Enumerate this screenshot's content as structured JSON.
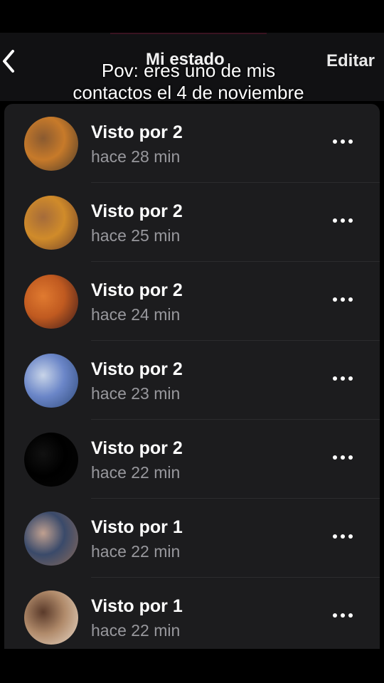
{
  "header": {
    "title": "Mi estado",
    "edit_label": "Editar",
    "back_icon": "chevron-left-icon"
  },
  "overlay_caption": "Pov: eres uno de mis contactos el 4 de noviembre",
  "status_list": [
    {
      "label": "Visto por 2",
      "time": "hace 28 min",
      "avatar_colors": [
        "#c77a2a",
        "#4a3a2a",
        "#8a5a30"
      ]
    },
    {
      "label": "Visto por 2",
      "time": "hace 25 min",
      "avatar_colors": [
        "#d08b2a",
        "#6b3e2a",
        "#a56b3a"
      ]
    },
    {
      "label": "Visto por 2",
      "time": "hace 24 min",
      "avatar_colors": [
        "#c05a20",
        "#3a1a1a",
        "#e07a30"
      ]
    },
    {
      "label": "Visto por 2",
      "time": "hace 23 min",
      "avatar_colors": [
        "#6b86c8",
        "#2f4a7a",
        "#c8d4e8"
      ]
    },
    {
      "label": "Visto por 2",
      "time": "hace 22 min",
      "avatar_colors": [
        "#000000",
        "#050505",
        "#111111"
      ]
    },
    {
      "label": "Visto por 1",
      "time": "hace 22 min",
      "avatar_colors": [
        "#3a4a6a",
        "#8a6a5a",
        "#c0a090"
      ]
    },
    {
      "label": "Visto por 1",
      "time": "hace 22 min",
      "avatar_colors": [
        "#b08a6a",
        "#e8d8c8",
        "#5a3a2a"
      ]
    }
  ],
  "more_icon": "ellipsis-icon"
}
